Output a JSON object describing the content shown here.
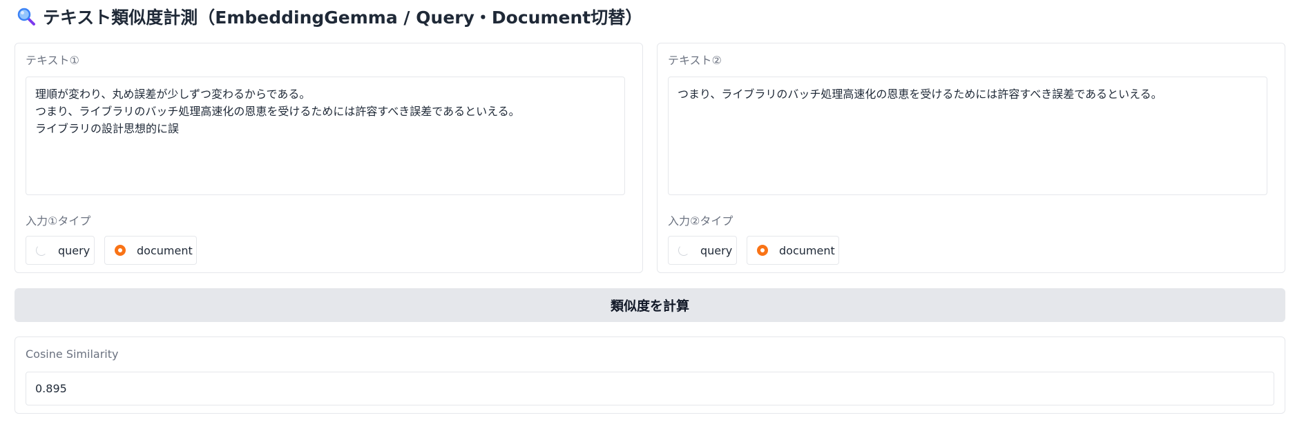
{
  "header": {
    "title": "テキスト類似度計測（EmbeddingGemma / Query・Document切替）",
    "icon": "magnifier-icon"
  },
  "input1": {
    "label": "テキスト①",
    "lines": [
      "理順が変わり、丸め誤差が少しずつ変わるからである。",
      "つまり、ライブラリのバッチ処理高速化の恩恵を受けるためには許容すべき誤差であるといえる。",
      "ライブラリの設計思想的に誤"
    ],
    "type_label": "入力①タイプ",
    "options": [
      "query",
      "document"
    ],
    "selected": "document"
  },
  "input2": {
    "label": "テキスト②",
    "lines": [
      "つまり、ライブラリのバッチ処理高速化の恩恵を受けるためには許容すべき誤差であるといえる。"
    ],
    "type_label": "入力②タイプ",
    "options": [
      "query",
      "document"
    ],
    "selected": "document"
  },
  "compute_button": {
    "label": "類似度を計算"
  },
  "result": {
    "label": "Cosine Similarity",
    "value": "0.895"
  },
  "colors": {
    "accent": "#f97316",
    "button_bg": "#e5e7eb",
    "border": "#e5e7eb",
    "label_text": "#6b7280"
  }
}
